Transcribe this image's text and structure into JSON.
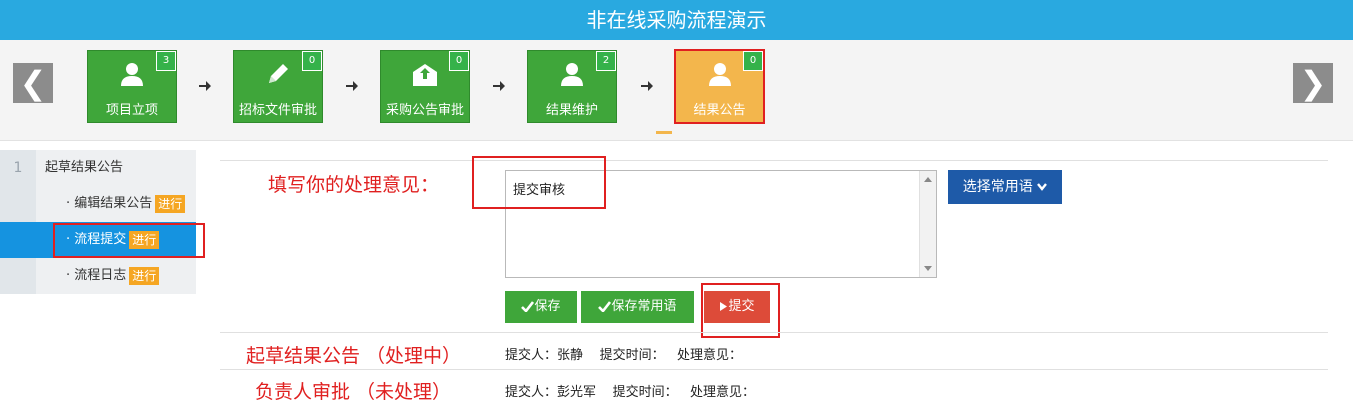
{
  "header": {
    "title": "非在线采购流程演示"
  },
  "nav": {
    "prev": "❮",
    "next": "❯"
  },
  "steps": [
    {
      "label": "项目立项",
      "count": "3",
      "icon": "user-icon"
    },
    {
      "label": "招标文件审批",
      "count": "0",
      "icon": "pencil-icon"
    },
    {
      "label": "采购公告审批",
      "count": "0",
      "icon": "envelope-upload-icon"
    },
    {
      "label": "结果维护",
      "count": "2",
      "icon": "user-icon"
    },
    {
      "label": "结果公告",
      "count": "0",
      "icon": "user-icon",
      "active": true
    }
  ],
  "sidebar": {
    "section_num": "1",
    "section_title": "起草结果公告",
    "items": [
      {
        "label": "· 编辑结果公告",
        "tag": "进行"
      },
      {
        "label": "· 流程提交",
        "tag": "进行",
        "selected": true
      },
      {
        "label": "· 流程日志",
        "tag": "进行"
      }
    ]
  },
  "form": {
    "prompt_label": "填写你的处理意见：",
    "opinion_value": "提交审核",
    "phrase_button": "选择常用语",
    "save_button": "保存",
    "save_phrase_button": "保存常用语",
    "submit_button": "提交"
  },
  "log": [
    {
      "title": "起草结果公告 （处理中）",
      "submitter_label": "提交人：",
      "submitter": "张静",
      "time_label": "提交时间：",
      "time": "",
      "opinion_label": "处理意见：",
      "opinion": ""
    },
    {
      "title": "负责人审批 （未处理）",
      "submitter_label": "提交人：",
      "submitter": "彭光军",
      "time_label": "提交时间：",
      "time": "",
      "opinion_label": "处理意见：",
      "opinion": ""
    }
  ],
  "colors": {
    "header": "#29a9e0",
    "step_green": "#3fa63a",
    "step_active": "#f3b64c",
    "highlight_red": "#e02020",
    "tag_orange": "#f5a623",
    "phrase_blue": "#1e5aa8",
    "submit_red": "#dd4b39"
  }
}
